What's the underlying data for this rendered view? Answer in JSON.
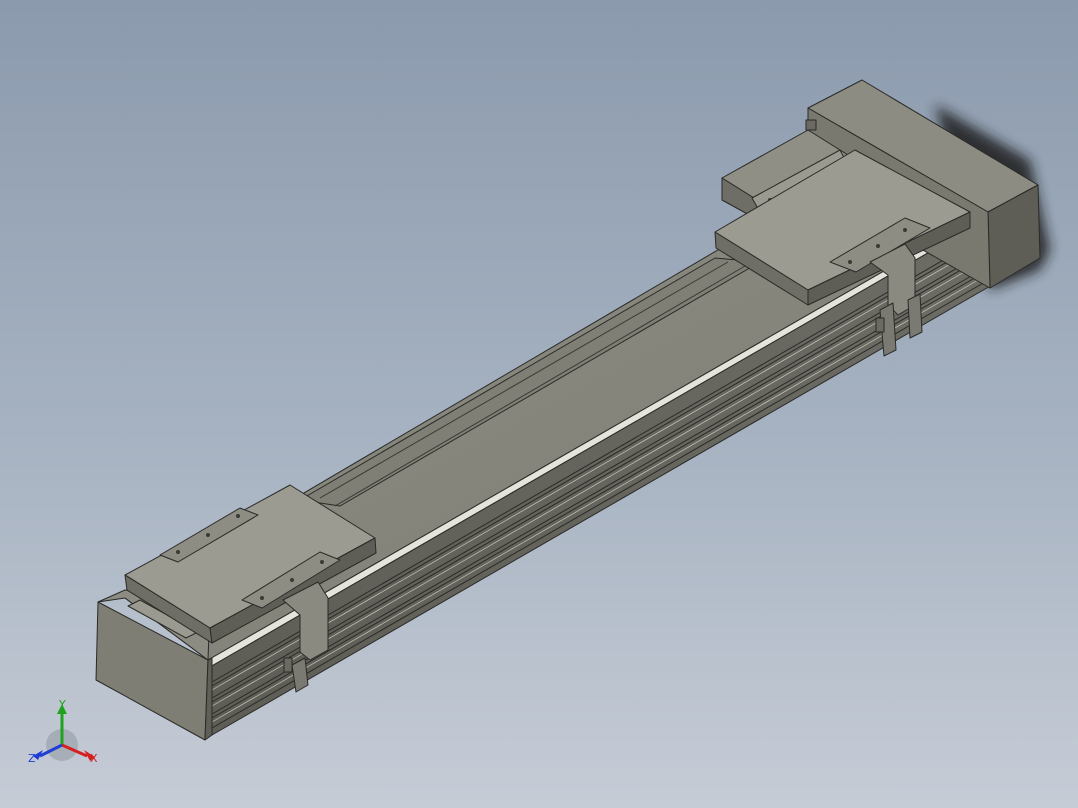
{
  "view": {
    "background_top": "#8b9aad",
    "background_bottom": "#c6ccd6"
  },
  "model": {
    "type": "linear-actuator-module",
    "body_color": "#8a8a80",
    "edge_color": "#2a2a28"
  },
  "triad": {
    "x_label": "X",
    "y_label": "Y",
    "z_label": "Z",
    "x_color": "#d42020",
    "y_color": "#1fa31f",
    "z_color": "#1f3fd4"
  }
}
